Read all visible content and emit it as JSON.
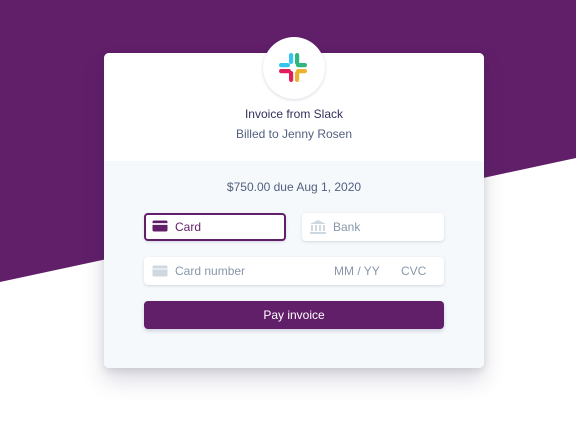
{
  "colors": {
    "brand": "#611f69",
    "panel_background": "#f6f9fc",
    "placeholder_text": "#8898aa",
    "slack_red": "#e01e5a",
    "slack_blue": "#36c5f0",
    "slack_green": "#2eb67d",
    "slack_yellow": "#ecb22e"
  },
  "header": {
    "logo_icon": "slack-logo",
    "title": "Invoice from Slack",
    "billed_to": "Billed to Jenny Rosen"
  },
  "payment": {
    "amount_due": "$750.00 due Aug 1, 2020",
    "tabs": [
      {
        "label": "Card",
        "icon": "credit-card-icon",
        "selected": true
      },
      {
        "label": "Bank",
        "icon": "bank-icon",
        "selected": false
      }
    ],
    "card_field": {
      "icon": "credit-card-icon",
      "number_placeholder": "Card number",
      "expiry_placeholder": "MM / YY",
      "cvc_placeholder": "CVC"
    },
    "pay_button_label": "Pay invoice"
  }
}
